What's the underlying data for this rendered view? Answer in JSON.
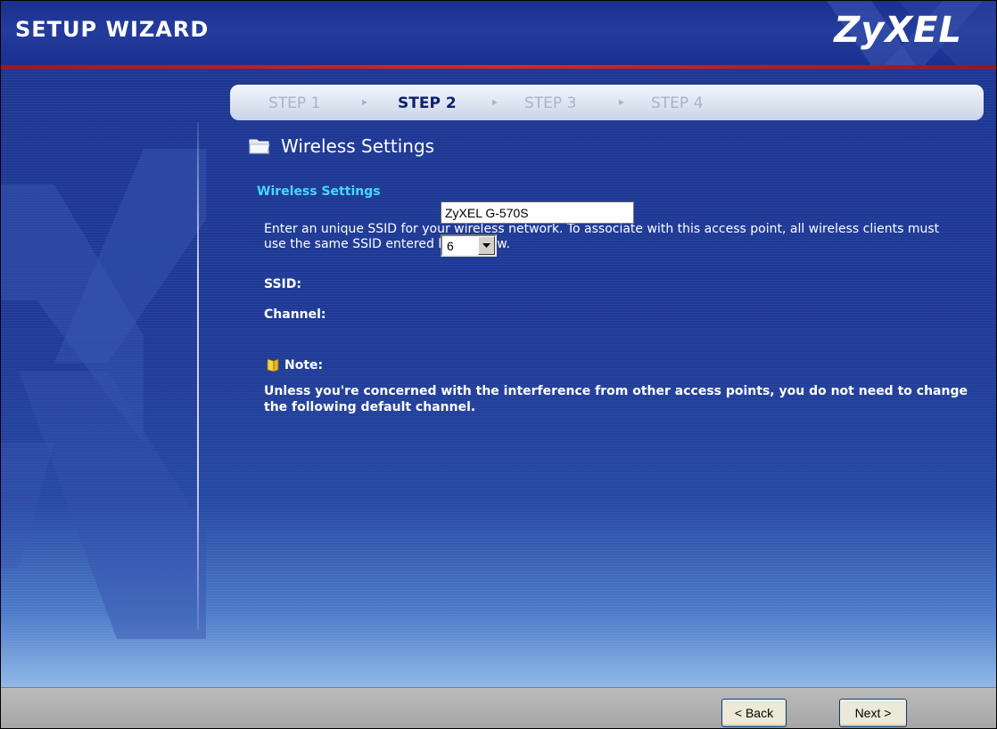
{
  "header": {
    "title": "SETUP WIZARD",
    "logo": "ZyXEL"
  },
  "steps": [
    {
      "label": "STEP 1",
      "active": false
    },
    {
      "label": "STEP 2",
      "active": true
    },
    {
      "label": "STEP 3",
      "active": false
    },
    {
      "label": "STEP 4",
      "active": false
    }
  ],
  "page": {
    "heading": "Wireless Settings",
    "subheading": "Wireless Settings",
    "description": "Enter an unique SSID for your wireless network. To associate with this access point, all wireless clients must use the same SSID entered here below."
  },
  "form": {
    "ssid_label": "SSID:",
    "ssid_value": "ZyXEL G-570S",
    "channel_label": "Channel:",
    "channel_value": "6"
  },
  "note": {
    "label": "Note:",
    "text": "Unless you're concerned with the interference from other access points, you do not need to change the following default channel."
  },
  "buttons": {
    "back": "< Back",
    "next": "Next >"
  },
  "colors": {
    "background": "#1f3b97",
    "accent_red": "#e02424",
    "subheading": "#44d9ff"
  },
  "icons": [
    "folder-icon",
    "note-icon",
    "dropdown-arrow-icon"
  ]
}
